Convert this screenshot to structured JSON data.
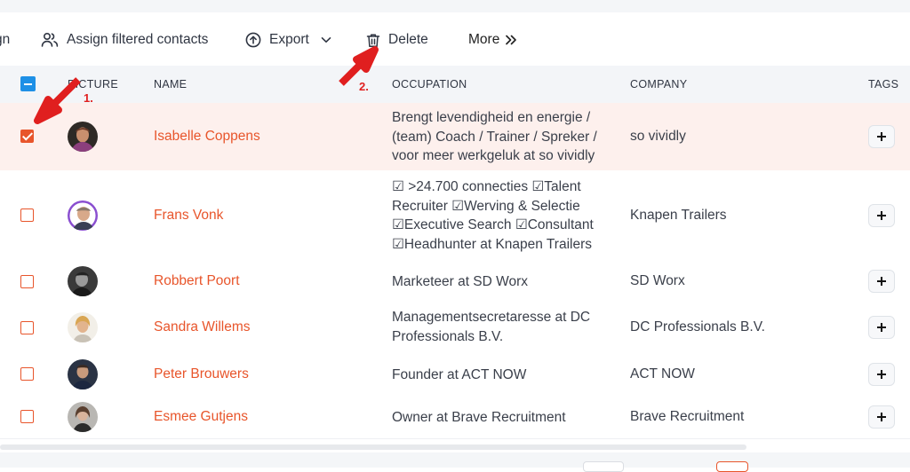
{
  "toolbar": {
    "partial_label": "gn",
    "assign_label": "Assign filtered contacts",
    "export_label": "Export",
    "delete_label": "Delete",
    "more_label": "More"
  },
  "table": {
    "headers": {
      "picture": "PICTURE",
      "name": "NAME",
      "occupation": "OCCUPATION",
      "company": "COMPANY",
      "tags": "TAGS"
    },
    "rows": [
      {
        "name": "Isabelle Coppens",
        "occupation": [
          "Brengt levendigheid en energie /",
          "(team) Coach / Trainer / Spreker /",
          "voor meer werkgeluk at so vividly"
        ],
        "company": "so vividly",
        "selected": true
      },
      {
        "name": "Frans Vonk",
        "occupation": [
          "☑ >24.700 connecties ☑Talent",
          "Recruiter ☑Werving & Selectie",
          "☑Executive Search ☑Consultant",
          "☑Headhunter at Knapen Trailers"
        ],
        "company": "Knapen Trailers",
        "selected": false
      },
      {
        "name": "Robbert Poort",
        "occupation": [
          "Marketeer at SD Worx"
        ],
        "company": "SD Worx",
        "selected": false
      },
      {
        "name": "Sandra Willems",
        "occupation": [
          "Managementsecretaresse at DC",
          "Professionals B.V."
        ],
        "company": "DC Professionals B.V.",
        "selected": false
      },
      {
        "name": "Peter Brouwers",
        "occupation": [
          "Founder at ACT NOW"
        ],
        "company": "ACT NOW",
        "selected": false
      },
      {
        "name": "Esmee Gutjens",
        "occupation": [
          "Owner at Brave Recruitment"
        ],
        "company": "Brave Recruitment",
        "selected": false
      }
    ]
  },
  "annotations": {
    "step1": "1.",
    "step2": "2."
  },
  "colors": {
    "accent": "#e8552b",
    "header_checkbox": "#1e90e6",
    "selected_row": "#fdf0ed",
    "annotation": "#e01f1f"
  },
  "icons": {
    "assign": "users-icon",
    "export": "upload-circle-icon",
    "export_caret": "chevron-down-icon",
    "delete": "trash-icon",
    "more": "double-chevron-right-icon"
  }
}
